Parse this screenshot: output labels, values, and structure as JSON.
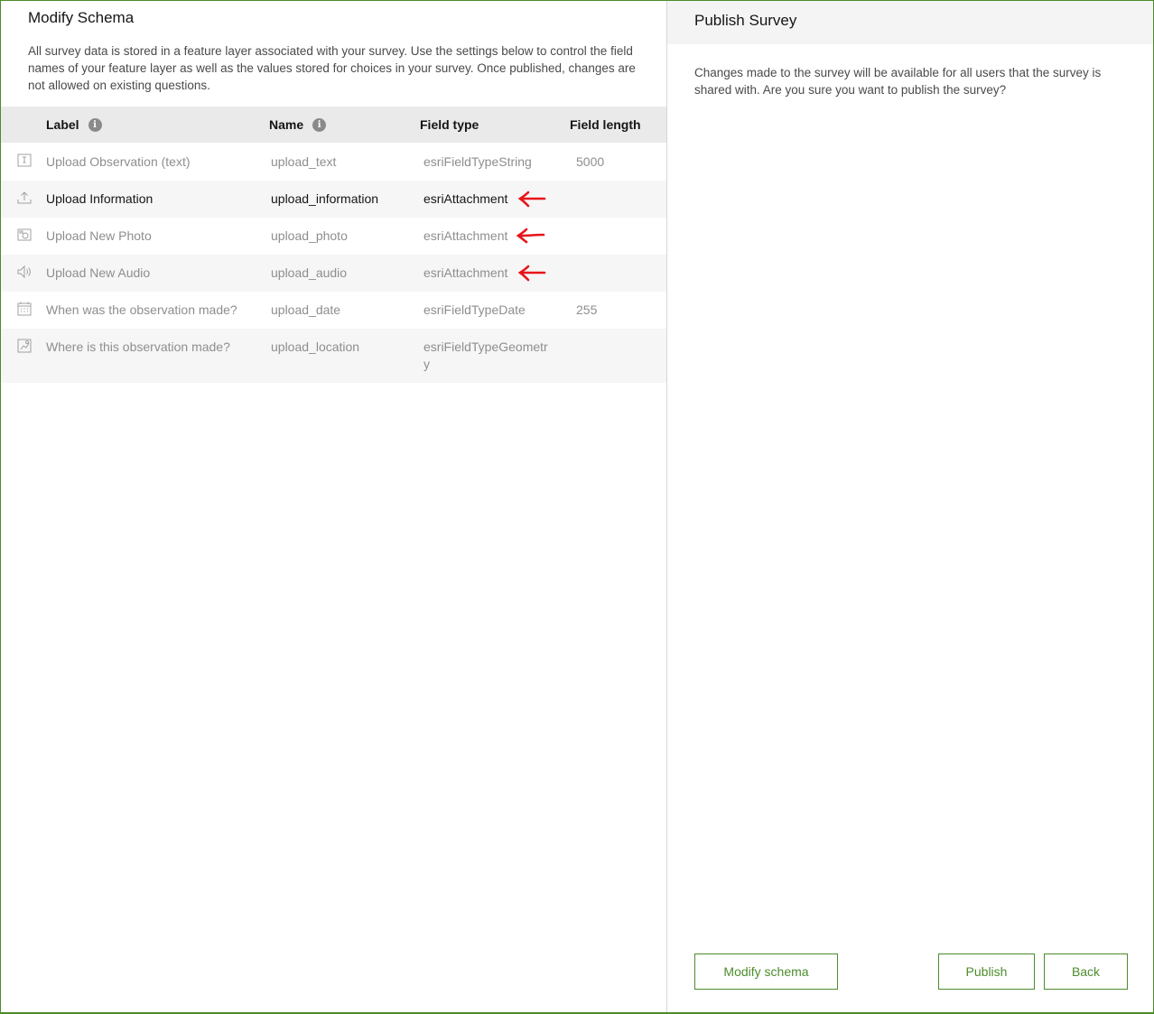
{
  "left_panel": {
    "title": "Modify Schema",
    "description": "All survey data is stored in a feature layer associated with your survey. Use the settings below to control the field names of your feature layer as well as the values stored for choices in your survey. Once published, changes are not allowed on existing questions.",
    "table": {
      "headers": {
        "label": "Label",
        "name": "Name",
        "field_type": "Field type",
        "field_length": "Field length"
      },
      "rows": [
        {
          "icon": "text-field-icon",
          "label": "Upload Observation (text)",
          "name": "upload_text",
          "field_type": "esriFieldTypeString",
          "field_length": "5000"
        },
        {
          "icon": "upload-icon",
          "label": "Upload Information",
          "name": "upload_information",
          "field_type": "esriAttachment",
          "field_length": ""
        },
        {
          "icon": "camera-icon",
          "label": "Upload New Photo",
          "name": "upload_photo",
          "field_type": "esriAttachment",
          "field_length": ""
        },
        {
          "icon": "speaker-icon",
          "label": "Upload New Audio",
          "name": "upload_audio",
          "field_type": "esriAttachment",
          "field_length": ""
        },
        {
          "icon": "calendar-icon",
          "label": "When was the observation made?",
          "name": "upload_date",
          "field_type": "esriFieldTypeDate",
          "field_length": "255"
        },
        {
          "icon": "map-pin-icon",
          "label": "Where is this observation made?",
          "name": "upload_location",
          "field_type": "esriFieldTypeGeometr",
          "field_type_wrap": "y",
          "field_length": ""
        }
      ]
    }
  },
  "right_panel": {
    "title": "Publish Survey",
    "message": "Changes made to the survey will be available for all users that the survey is shared with. Are you sure you want to publish the survey?",
    "buttons": {
      "modify_schema": "Modify schema",
      "publish": "Publish",
      "back": "Back"
    }
  },
  "colors": {
    "accent": "#4c8c2b",
    "annotation": "#e8141b"
  }
}
